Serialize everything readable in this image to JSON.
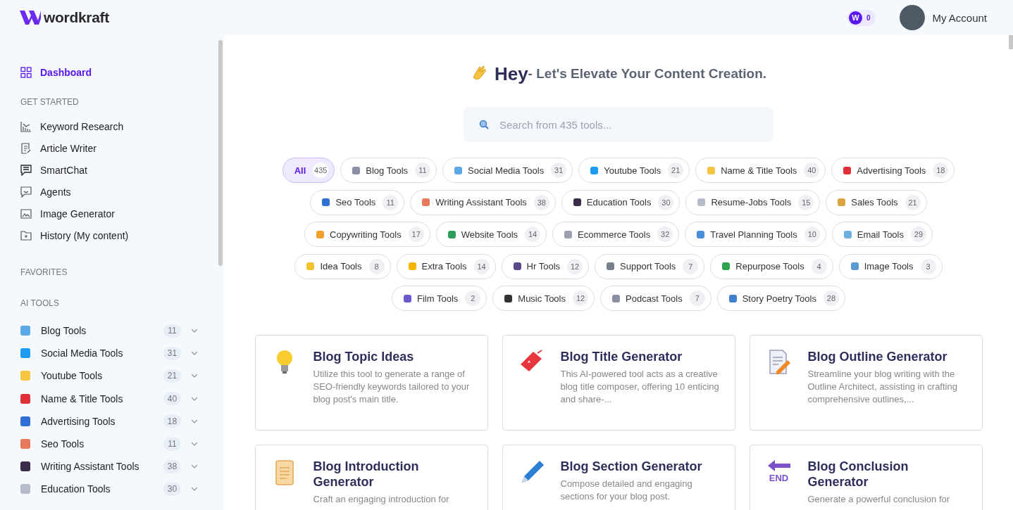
{
  "header": {
    "logo": "wordkraft",
    "credit_badge": "W",
    "credits": "0",
    "account": "My Account"
  },
  "sidebar": {
    "nav": [
      {
        "label": "Dashboard",
        "selected": true
      }
    ],
    "get_started": {
      "title": "GET STARTED",
      "items": [
        {
          "label": "Keyword Research"
        },
        {
          "label": "Article Writer"
        },
        {
          "label": "SmartChat"
        },
        {
          "label": "Agents"
        },
        {
          "label": "Image Generator"
        },
        {
          "label": "History (My content)"
        }
      ]
    },
    "favorites": {
      "title": "FAVORITES"
    },
    "ai_tools": {
      "title": "AI TOOLS",
      "items": [
        {
          "label": "Blog Tools",
          "count": "11",
          "expanded": false
        },
        {
          "label": "Social Media Tools",
          "count": "31",
          "expanded": false
        },
        {
          "label": "Youtube Tools",
          "count": "21",
          "expanded": false
        },
        {
          "label": "Name & Title Tools",
          "count": "40",
          "expanded": false
        },
        {
          "label": "Advertising Tools",
          "count": "18",
          "expanded": false
        },
        {
          "label": "Seo Tools",
          "count": "11",
          "expanded": false
        },
        {
          "label": "Writing Assistant Tools",
          "count": "38",
          "expanded": false
        },
        {
          "label": "Education Tools",
          "count": "30",
          "expanded": false
        }
      ]
    }
  },
  "main": {
    "greeting": "Hey",
    "headline": "- Let's Elevate Your Content Creation.",
    "search": {
      "placeholder": "Search from 435 tools..."
    },
    "categories": [
      {
        "label": "All",
        "count": "435",
        "selected": true
      },
      {
        "label": "Blog Tools",
        "count": "11",
        "selected": false
      },
      {
        "label": "Social Media Tools",
        "count": "31",
        "selected": false
      },
      {
        "label": "Youtube Tools",
        "count": "21",
        "selected": false
      },
      {
        "label": "Name & Title Tools",
        "count": "40",
        "selected": false
      },
      {
        "label": "Advertising Tools",
        "count": "18",
        "selected": false
      },
      {
        "label": "Seo Tools",
        "count": "11",
        "selected": false
      },
      {
        "label": "Writing Assistant Tools",
        "count": "38",
        "selected": false
      },
      {
        "label": "Education Tools",
        "count": "30",
        "selected": false
      },
      {
        "label": "Resume-Jobs Tools",
        "count": "15",
        "selected": false
      },
      {
        "label": "Sales Tools",
        "count": "21",
        "selected": false
      },
      {
        "label": "Copywriting Tools",
        "count": "17",
        "selected": false
      },
      {
        "label": "Website Tools",
        "count": "14",
        "selected": false
      },
      {
        "label": "Ecommerce Tools",
        "count": "32",
        "selected": false
      },
      {
        "label": "Travel Planning Tools",
        "count": "10",
        "selected": false
      },
      {
        "label": "Email Tools",
        "count": "29",
        "selected": false
      },
      {
        "label": "Idea Tools",
        "count": "8",
        "selected": false
      },
      {
        "label": "Extra Tools",
        "count": "14",
        "selected": false
      },
      {
        "label": "Hr Tools",
        "count": "12",
        "selected": false
      },
      {
        "label": "Support Tools",
        "count": "7",
        "selected": false
      },
      {
        "label": "Repurpose Tools",
        "count": "4",
        "selected": false
      },
      {
        "label": "Image Tools",
        "count": "3",
        "selected": false
      },
      {
        "label": "Film Tools",
        "count": "2",
        "selected": false
      },
      {
        "label": "Music Tools",
        "count": "12",
        "selected": false
      },
      {
        "label": "Podcast Tools",
        "count": "7",
        "selected": false
      },
      {
        "label": "Story Poetry Tools",
        "count": "28",
        "selected": false
      }
    ],
    "cards": [
      {
        "title": "Blog Topic Ideas",
        "description": "Utilize this tool to generate a range of SEO-friendly keywords tailored to your blog post's main title."
      },
      {
        "title": "Blog Title Generator",
        "description": "This AI-powered tool acts as a creative blog title composer, offering 10 enticing and share-..."
      },
      {
        "title": "Blog Outline Generator",
        "description": "Streamline your blog writing with the Outline Architect, assisting in crafting comprehensive outlines,..."
      },
      {
        "title": "Blog Introduction Generator",
        "description": "Craft an engaging introduction for"
      },
      {
        "title": "Blog Section Generator",
        "description": "Compose detailed and engaging sections for your blog post."
      },
      {
        "title": "Blog Conclusion Generator",
        "description": "Generate a powerful conclusion for",
        "icon_label": "END"
      }
    ]
  }
}
